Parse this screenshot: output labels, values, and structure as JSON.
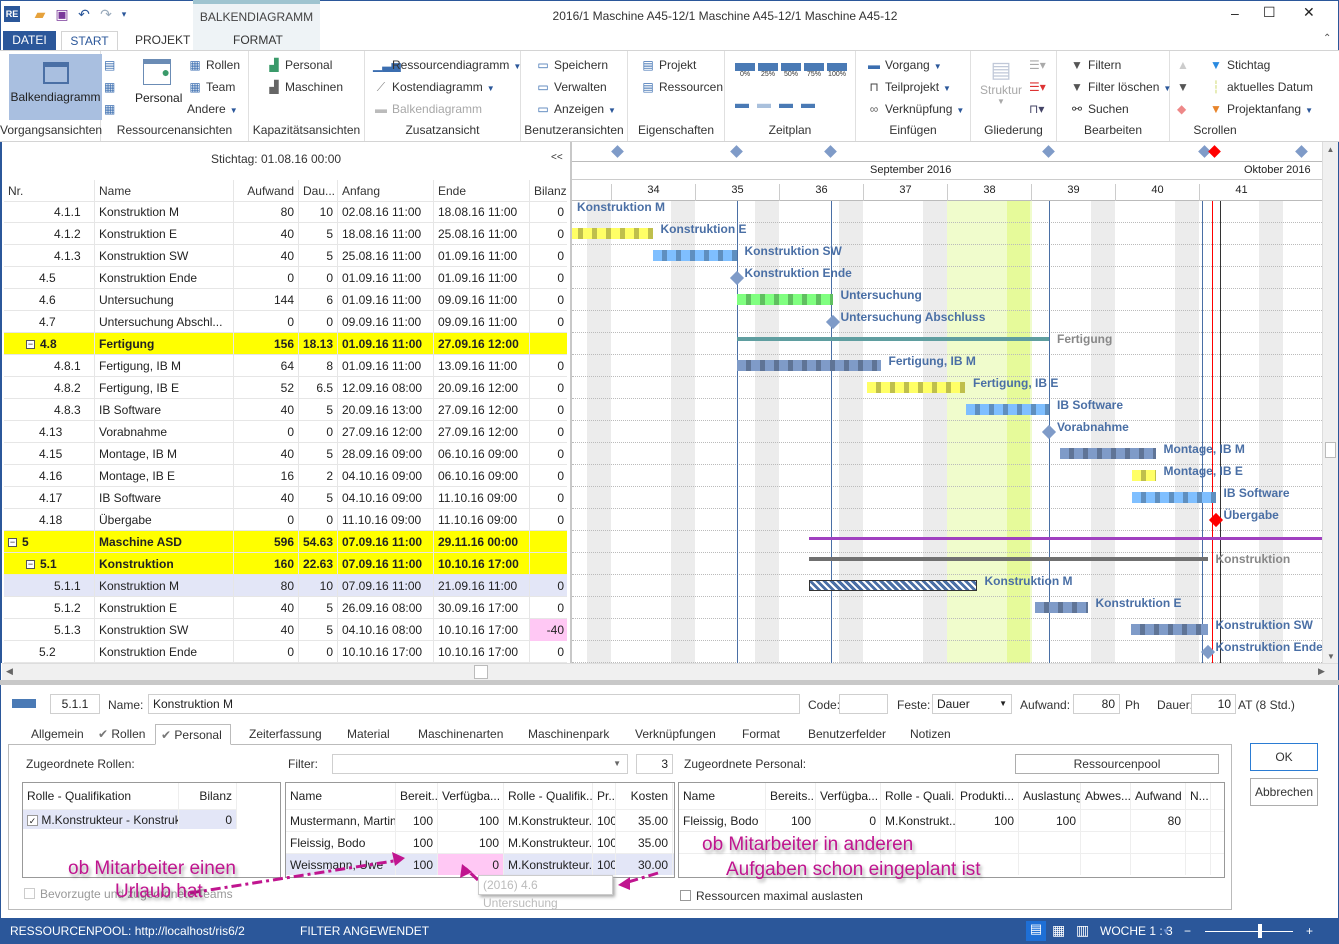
{
  "app": {
    "title": "2016/1 Maschine A45-12/1 Maschine A45-12/1 Maschine A45-12",
    "context_tab": "BALKENDIAGRAMM",
    "logo": "RE"
  },
  "tabs": [
    "DATEI",
    "START",
    "PROJEKT",
    "FORMAT"
  ],
  "ribbon": {
    "vorgang": {
      "label": "Vorgangsansichten",
      "main": "Balkendiagramm"
    },
    "ressourcen": {
      "label": "Ressourcenansichten",
      "main": "Personal",
      "rollen": "Rollen",
      "team": "Team",
      "andere": "Andere"
    },
    "kapazitaet": {
      "label": "Kapazitätsansichten",
      "personal": "Personal",
      "maschinen": "Maschinen"
    },
    "zusatz": {
      "label": "Zusatzansicht",
      "ressourcendiagramm": "Ressourcendiagramm",
      "kostendiagramm": "Kostendiagramm",
      "balkendiagramm": "Balkendiagramm"
    },
    "benutzer": {
      "label": "Benutzeransichten",
      "speichern": "Speichern",
      "verwalten": "Verwalten",
      "anzeigen": "Anzeigen"
    },
    "eigenschaften": {
      "label": "Eigenschaften",
      "projekt": "Projekt",
      "ressourcen": "Ressourcen"
    },
    "zeitplan": {
      "label": "Zeitplan",
      "percents": [
        "0%",
        "25%",
        "50%",
        "75%",
        "100%"
      ]
    },
    "einfuegen": {
      "label": "Einfügen",
      "vorgang": "Vorgang",
      "teilprojekt": "Teilprojekt",
      "verknuepfung": "Verknüpfung"
    },
    "gliederung": {
      "label": "Gliederung",
      "struktur": "Struktur"
    },
    "bearbeiten": {
      "label": "Bearbeiten",
      "filtern": "Filtern",
      "filter_loeschen": "Filter löschen",
      "suchen": "Suchen"
    },
    "scrollen": {
      "label": "Scrollen",
      "stichtag": "Stichtag",
      "aktuelles_datum": "aktuelles Datum",
      "projektanfang": "Projektanfang"
    }
  },
  "table": {
    "stichtag": "Stichtag: 01.08.16 00:00",
    "collapse": "<<",
    "columns": [
      "Nr.",
      "Name",
      "Aufwand",
      "Dau...",
      "Anfang",
      "Ende",
      "Bilanz"
    ],
    "rows": [
      {
        "nr": "4.1.1",
        "name": "Konstruktion M",
        "aufwand": "80",
        "dauer": "10",
        "anfang": "02.08.16 11:00",
        "ende": "18.08.16 11:00",
        "bilanz": "0",
        "level": 3,
        "bar": "blue",
        "label": "Konstruktion M"
      },
      {
        "nr": "4.1.2",
        "name": "Konstruktion E",
        "aufwand": "40",
        "dauer": "5",
        "anfang": "18.08.16 11:00",
        "ende": "25.08.16 11:00",
        "bilanz": "0",
        "level": 3,
        "bar": "yellow",
        "label": "Konstruktion E"
      },
      {
        "nr": "4.1.3",
        "name": "Konstruktion SW",
        "aufwand": "40",
        "dauer": "5",
        "anfang": "25.08.16 11:00",
        "ende": "01.09.16 11:00",
        "bilanz": "0",
        "level": 3,
        "bar": "lightblue",
        "label": "Konstruktion SW"
      },
      {
        "nr": "4.5",
        "name": "Konstruktion Ende",
        "aufwand": "0",
        "dauer": "0",
        "anfang": "01.09.16 11:00",
        "ende": "01.09.16 11:00",
        "bilanz": "0",
        "level": 2,
        "bar": "milestone",
        "label": "Konstruktion Ende"
      },
      {
        "nr": "4.6",
        "name": "Untersuchung",
        "aufwand": "144",
        "dauer": "6",
        "anfang": "01.09.16 11:00",
        "ende": "09.09.16 11:00",
        "bilanz": "0",
        "level": 2,
        "bar": "green",
        "label": "Untersuchung"
      },
      {
        "nr": "4.7",
        "name": "Untersuchung Abschl...",
        "aufwand": "0",
        "dauer": "0",
        "anfang": "09.09.16 11:00",
        "ende": "09.09.16 11:00",
        "bilanz": "0",
        "level": 2,
        "bar": "milestone",
        "label": "Untersuchung Abschluss"
      },
      {
        "nr": "4.8",
        "name": "Fertigung",
        "aufwand": "156",
        "dauer": "18.13",
        "anfang": "01.09.16 11:00",
        "ende": "27.09.16 12:00",
        "bilanz": "",
        "level": 2,
        "summary": true,
        "bar": "summary",
        "label": "Fertigung"
      },
      {
        "nr": "4.8.1",
        "name": "Fertigung, IB M",
        "aufwand": "64",
        "dauer": "8",
        "anfang": "01.09.16 11:00",
        "ende": "13.09.16 11:00",
        "bilanz": "0",
        "level": 3,
        "bar": "steel",
        "label": "Fertigung, IB M"
      },
      {
        "nr": "4.8.2",
        "name": "Fertigung, IB E",
        "aufwand": "52",
        "dauer": "6.5",
        "anfang": "12.09.16 08:00",
        "ende": "20.09.16 12:00",
        "bilanz": "0",
        "level": 3,
        "bar": "yellow",
        "label": "Fertigung, IB E"
      },
      {
        "nr": "4.8.3",
        "name": "IB Software",
        "aufwand": "40",
        "dauer": "5",
        "anfang": "20.09.16 13:00",
        "ende": "27.09.16 12:00",
        "bilanz": "0",
        "level": 3,
        "bar": "lightblue",
        "label": "IB Software"
      },
      {
        "nr": "4.13",
        "name": "Vorabnahme",
        "aufwand": "0",
        "dauer": "0",
        "anfang": "27.09.16 12:00",
        "ende": "27.09.16 12:00",
        "bilanz": "0",
        "level": 2,
        "bar": "milestone",
        "label": "Vorabnahme"
      },
      {
        "nr": "4.15",
        "name": "Montage, IB M",
        "aufwand": "40",
        "dauer": "5",
        "anfang": "28.09.16 09:00",
        "ende": "06.10.16 09:00",
        "bilanz": "0",
        "level": 2,
        "bar": "steel",
        "label": "Montage, IB M"
      },
      {
        "nr": "4.16",
        "name": "Montage, IB E",
        "aufwand": "16",
        "dauer": "2",
        "anfang": "04.10.16 09:00",
        "ende": "06.10.16 09:00",
        "bilanz": "0",
        "level": 2,
        "bar": "yellow",
        "label": "Montage, IB E"
      },
      {
        "nr": "4.17",
        "name": "IB Software",
        "aufwand": "40",
        "dauer": "5",
        "anfang": "04.10.16 09:00",
        "ende": "11.10.16 09:00",
        "bilanz": "0",
        "level": 2,
        "bar": "lightblue",
        "label": "IB Software"
      },
      {
        "nr": "4.18",
        "name": "Übergabe",
        "aufwand": "0",
        "dauer": "0",
        "anfang": "11.10.16 09:00",
        "ende": "11.10.16 09:00",
        "bilanz": "0",
        "level": 2,
        "bar": "milestone-red",
        "label": "Übergabe"
      },
      {
        "nr": "5",
        "name": "Maschine ASD",
        "aufwand": "596",
        "dauer": "54.63",
        "anfang": "07.09.16 11:00",
        "ende": "29.11.16 00:00",
        "bilanz": "",
        "level": 1,
        "summary": true,
        "bar": "project",
        "label": ""
      },
      {
        "nr": "5.1",
        "name": "Konstruktion",
        "aufwand": "160",
        "dauer": "22.63",
        "anfang": "07.09.16 11:00",
        "ende": "10.10.16 17:00",
        "bilanz": "",
        "level": 2,
        "summary": true,
        "bar": "summary-dark",
        "label": "Konstruktion"
      },
      {
        "nr": "5.1.1",
        "name": "Konstruktion M",
        "aufwand": "80",
        "dauer": "10",
        "anfang": "07.09.16 11:00",
        "ende": "21.09.16 11:00",
        "bilanz": "0",
        "level": 3,
        "selected": true,
        "bar": "hatched",
        "label": "Konstruktion M"
      },
      {
        "nr": "5.1.2",
        "name": "Konstruktion E",
        "aufwand": "40",
        "dauer": "5",
        "anfang": "26.09.16 08:00",
        "ende": "30.09.16 17:00",
        "bilanz": "0",
        "level": 3,
        "bar": "steel",
        "label": "Konstruktion E"
      },
      {
        "nr": "5.1.3",
        "name": "Konstruktion SW",
        "aufwand": "40",
        "dauer": "5",
        "anfang": "04.10.16 08:00",
        "ende": "10.10.16 17:00",
        "bilanz": "-40",
        "level": 3,
        "bilanz_alert": true,
        "bar": "steel",
        "label": "Konstruktion SW"
      },
      {
        "nr": "5.2",
        "name": "Konstruktion Ende",
        "aufwand": "0",
        "dauer": "0",
        "anfang": "10.10.16 17:00",
        "ende": "10.10.16 17:00",
        "bilanz": "0",
        "level": 2,
        "bar": "milestone",
        "label": "Konstruktion Ende"
      }
    ]
  },
  "gantt": {
    "months": [
      "September 2016",
      "Oktober 2016"
    ],
    "weeks": [
      "34",
      "35",
      "36",
      "37",
      "38",
      "39",
      "40",
      "41"
    ],
    "colors": {
      "blue": "#5b8fd6",
      "yellow": "#ffff66",
      "lightblue": "#7fbfff",
      "green": "#80ff80",
      "steel": "#7f9bc8",
      "milestone": "#7f9bc8",
      "milestone-red": "#ff0000",
      "summary": "#5f9ea0",
      "summary-dark": "#707070",
      "project": "#a040c0",
      "label": "#4a6fa5",
      "highlight": "#f0fccc",
      "weekend": "#ececec"
    }
  },
  "details": {
    "nr": "5.1.1",
    "name_label": "Name:",
    "name": "Konstruktion M",
    "code_label": "Code:",
    "code": "",
    "feste_label": "Feste:",
    "feste": "Dauer",
    "aufwand_label": "Aufwand:",
    "aufwand": "80",
    "aufwand_unit": "Ph",
    "dauer_label": "Dauer:",
    "dauer": "10",
    "dauer_unit": "AT (8 Std.)",
    "tabs": [
      {
        "label": "Allgemein"
      },
      {
        "label": "Rollen",
        "check": true
      },
      {
        "label": "Personal",
        "check": true,
        "active": true
      },
      {
        "label": "Zeiterfassung"
      },
      {
        "label": "Material"
      },
      {
        "label": "Maschinenarten"
      },
      {
        "label": "Maschinenpark"
      },
      {
        "label": "Verknüpfungen"
      },
      {
        "label": "Format"
      },
      {
        "label": "Benutzerfelder"
      },
      {
        "label": "Notizen"
      }
    ],
    "rollen_title": "Zugeordnete Rollen:",
    "rollen_cols": [
      "Rolle - Qualifikation",
      "Bilanz"
    ],
    "rollen_rows": [
      [
        "M.Konstrukteur - Konstrukteu",
        "0"
      ]
    ],
    "filter_label": "Filter:",
    "filter_value": "",
    "filter_count": "3",
    "pool_cols": [
      "Name",
      "Bereit...",
      "Verfügba...",
      "Rolle - Qualifik...",
      "Pr...",
      "Kosten"
    ],
    "pool_rows": [
      [
        "Mustermann, Martin",
        "100",
        "100",
        "M.Konstrukteur...",
        "100",
        "35.00"
      ],
      [
        "Fleissig, Bodo",
        "100",
        "100",
        "M.Konstrukteur...",
        "100",
        "35.00"
      ],
      [
        "Weissmann, Uwe",
        "100",
        "0",
        "M.Konstrukteur...",
        "100",
        "30.00"
      ]
    ],
    "personal_title": "Zugeordnete Personal:",
    "ressourcenpool_button": "Ressourcenpool",
    "personal_cols": [
      "Name",
      "Bereits...",
      "Verfügba...",
      "Rolle - Quali...",
      "Produkti...",
      "Auslastung",
      "Abwes...",
      "Aufwand",
      "N..."
    ],
    "personal_rows": [
      [
        "Fleissig, Bodo",
        "100",
        "0",
        "M.Konstrukt...",
        "100",
        "100",
        "",
        "80",
        ""
      ]
    ],
    "bevorzugte": "Bevorzugte und zugeordnete Teams",
    "max_auslasten": "Ressourcen maximal auslasten",
    "ok": "OK",
    "abbrechen": "Abbrechen",
    "tooltip": "(2016) 4.6 Untersuchung",
    "annotation_left": [
      "ob Mitarbeiter einen",
      "Urlaub hat"
    ],
    "annotation_right": [
      "ob Mitarbeiter in anderen",
      "Aufgaben schon eingeplant ist"
    ]
  },
  "status": {
    "pool": "RESSOURCENPOOL: http://localhost/ris6/2",
    "filter": "FILTER ANGEWENDET",
    "zoom_label": "WOCHE 1 : 3",
    "zoom_minus": "−",
    "zoom_plus": "+",
    "zoom_level": 0.6
  }
}
